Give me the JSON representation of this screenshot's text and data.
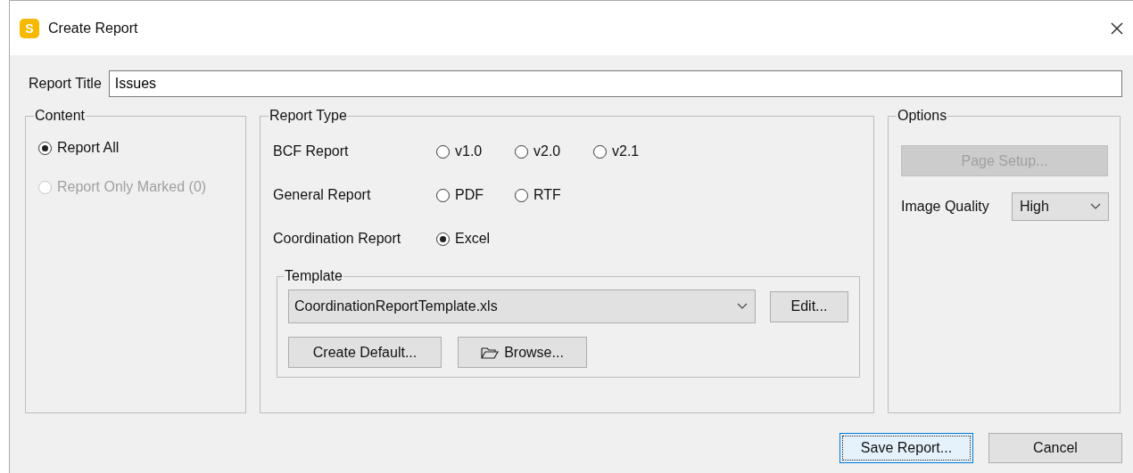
{
  "window": {
    "title": "Create Report",
    "app_icon_letter": "S"
  },
  "report_title": {
    "label": "Report Title",
    "value": "Issues"
  },
  "content": {
    "title": "Content",
    "options": [
      {
        "label": "Report All",
        "selected": true,
        "disabled": false
      },
      {
        "label": "Report Only Marked (0)",
        "selected": false,
        "disabled": true
      }
    ]
  },
  "report_type": {
    "title": "Report Type",
    "rows": [
      {
        "label": "BCF Report",
        "options": [
          {
            "label": "v1.0",
            "selected": false
          },
          {
            "label": "v2.0",
            "selected": false
          },
          {
            "label": "v2.1",
            "selected": false
          }
        ]
      },
      {
        "label": "General Report",
        "options": [
          {
            "label": "PDF",
            "selected": false
          },
          {
            "label": "RTF",
            "selected": false
          }
        ]
      },
      {
        "label": "Coordination Report",
        "options": [
          {
            "label": "Excel",
            "selected": true
          }
        ]
      }
    ],
    "template": {
      "title": "Template",
      "file": "CoordinationReportTemplate.xls",
      "edit_button": "Edit...",
      "create_default_button": "Create Default...",
      "browse_button": "Browse..."
    }
  },
  "options": {
    "title": "Options",
    "page_setup": {
      "label": "Page Setup...",
      "disabled": true
    },
    "image_quality": {
      "label": "Image Quality",
      "value": "High"
    }
  },
  "buttons": [
    {
      "label": "Save Report...",
      "default": true
    },
    {
      "label": "Cancel",
      "default": false
    }
  ]
}
